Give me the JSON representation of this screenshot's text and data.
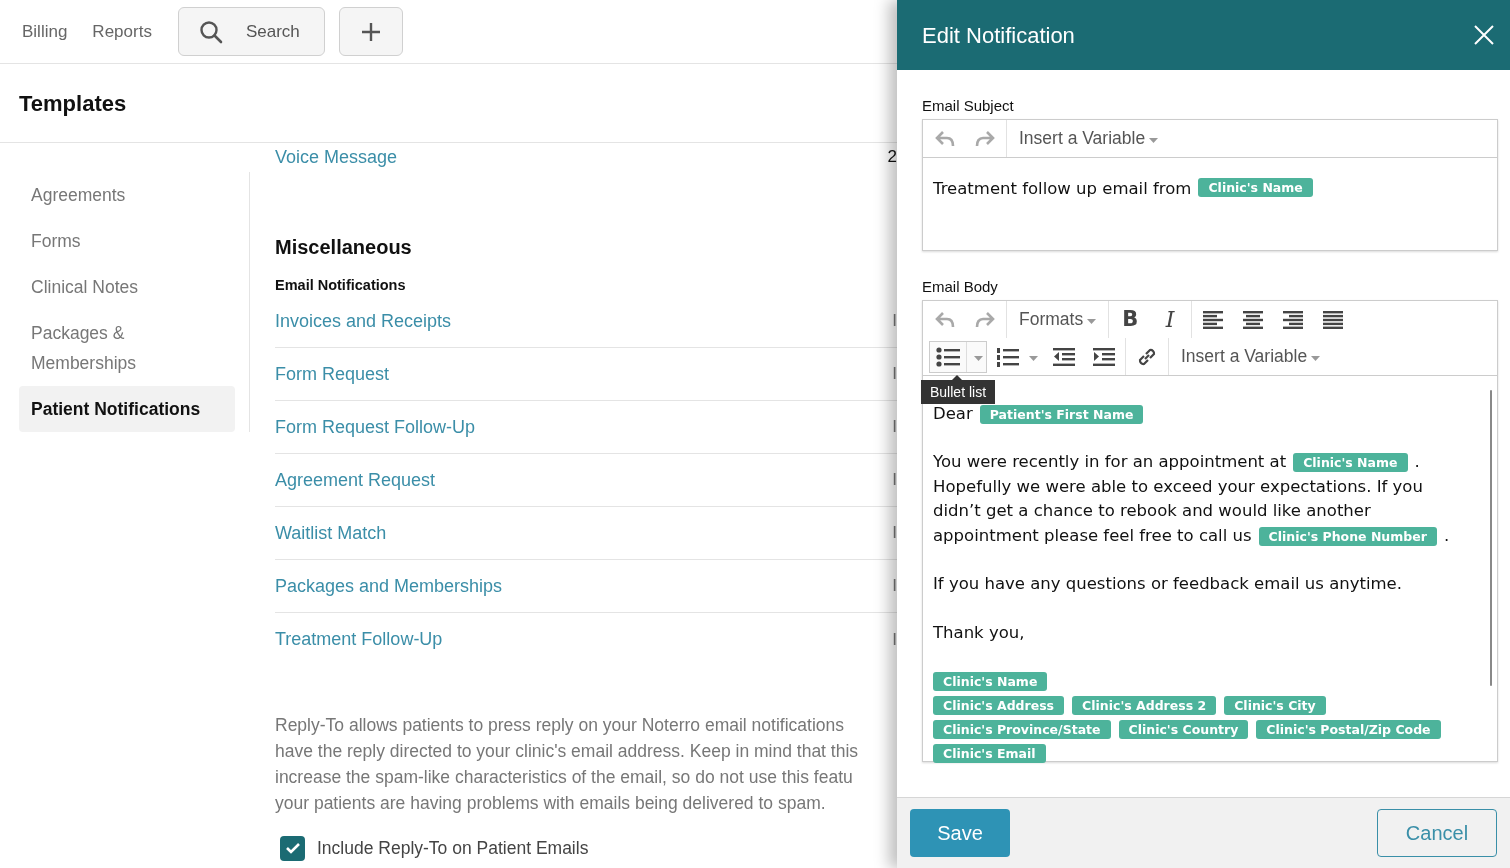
{
  "top_nav": {
    "links": [
      "Billing",
      "Reports"
    ],
    "search_label": "Search"
  },
  "page_title": "Templates",
  "sidebar": {
    "items": [
      {
        "label": "Agreements",
        "selected": false
      },
      {
        "label": "Forms",
        "selected": false
      },
      {
        "label": "Clinical Notes",
        "selected": false
      },
      {
        "label": "Packages & Memberships",
        "selected": false
      },
      {
        "label": "Patient Notifications",
        "selected": true
      }
    ]
  },
  "content": {
    "top_row": {
      "label": "Voice Message",
      "value": "2"
    },
    "section_title": "Miscellaneous",
    "subsection_title": "Email Notifications",
    "rows": [
      {
        "label": "Invoices and Receipts",
        "value": "I"
      },
      {
        "label": "Form Request",
        "value": "I"
      },
      {
        "label": "Form Request Follow-Up",
        "value": "I"
      },
      {
        "label": "Agreement Request",
        "value": "I"
      },
      {
        "label": "Waitlist Match",
        "value": "I"
      },
      {
        "label": "Packages and Memberships",
        "value": "I"
      },
      {
        "label": "Treatment Follow-Up",
        "value": "I"
      }
    ],
    "reply_to_note": [
      "Reply-To allows patients to press reply on your Noterro email notifications",
      "have the reply directed to your clinic's email address. Keep in mind that this",
      "increase the spam-like characteristics of the email, so do not use this featu",
      "your patients are having problems with emails being delivered to spam."
    ],
    "reply_to": {
      "label": "Include Reply-To on Patient Emails",
      "checked": true
    }
  },
  "drawer": {
    "title": "Edit Notification",
    "subject": {
      "label": "Email Subject",
      "variable_menu": "Insert a Variable",
      "content": [
        {
          "kind": "text",
          "text": "Treatment follow up email from"
        },
        {
          "kind": "tag",
          "text": "Clinic's Name"
        }
      ]
    },
    "body": {
      "label": "Email Body",
      "formats_menu": "Formats",
      "bold_label": "B",
      "italic_label": "I",
      "variable_menu": "Insert a Variable",
      "bullet_list_pressed": true,
      "tooltip": "Bullet list",
      "paragraphs": [
        [
          [
            {
              "kind": "text",
              "text": "Dear"
            },
            {
              "kind": "tag",
              "text": "Patient's First Name"
            }
          ]
        ],
        [
          [
            {
              "kind": "text",
              "text": "You were recently in for an appointment at"
            },
            {
              "kind": "tag",
              "text": "Clinic's Name"
            },
            {
              "kind": "text",
              "text": "."
            }
          ],
          [
            {
              "kind": "text",
              "text": "Hopefully we were able to exceed your expectations. If you"
            }
          ],
          [
            {
              "kind": "text",
              "text": "didn’t get a chance to rebook and would like another"
            }
          ],
          [
            {
              "kind": "text",
              "text": "appointment please feel free to call us"
            },
            {
              "kind": "tag",
              "text": "Clinic's Phone Number"
            },
            {
              "kind": "text",
              "text": "."
            }
          ]
        ],
        [
          [
            {
              "kind": "text",
              "text": "If you have any questions or feedback email us anytime."
            }
          ]
        ],
        [
          [
            {
              "kind": "text",
              "text": "Thank you,"
            }
          ]
        ],
        [
          [
            {
              "kind": "tag",
              "text": "Clinic's Name"
            }
          ],
          [
            {
              "kind": "tag",
              "text": "Clinic's Address"
            },
            {
              "kind": "tag",
              "text": "Clinic's Address 2"
            },
            {
              "kind": "tag",
              "text": "Clinic's City"
            }
          ],
          [
            {
              "kind": "tag",
              "text": "Clinic's Province/State"
            },
            {
              "kind": "tag",
              "text": "Clinic's Country"
            },
            {
              "kind": "tag",
              "text": "Clinic's Postal/Zip Code"
            }
          ],
          [
            {
              "kind": "tag",
              "text": "Clinic's Email"
            }
          ]
        ]
      ]
    },
    "buttons": {
      "save": "Save",
      "cancel": "Cancel"
    }
  }
}
